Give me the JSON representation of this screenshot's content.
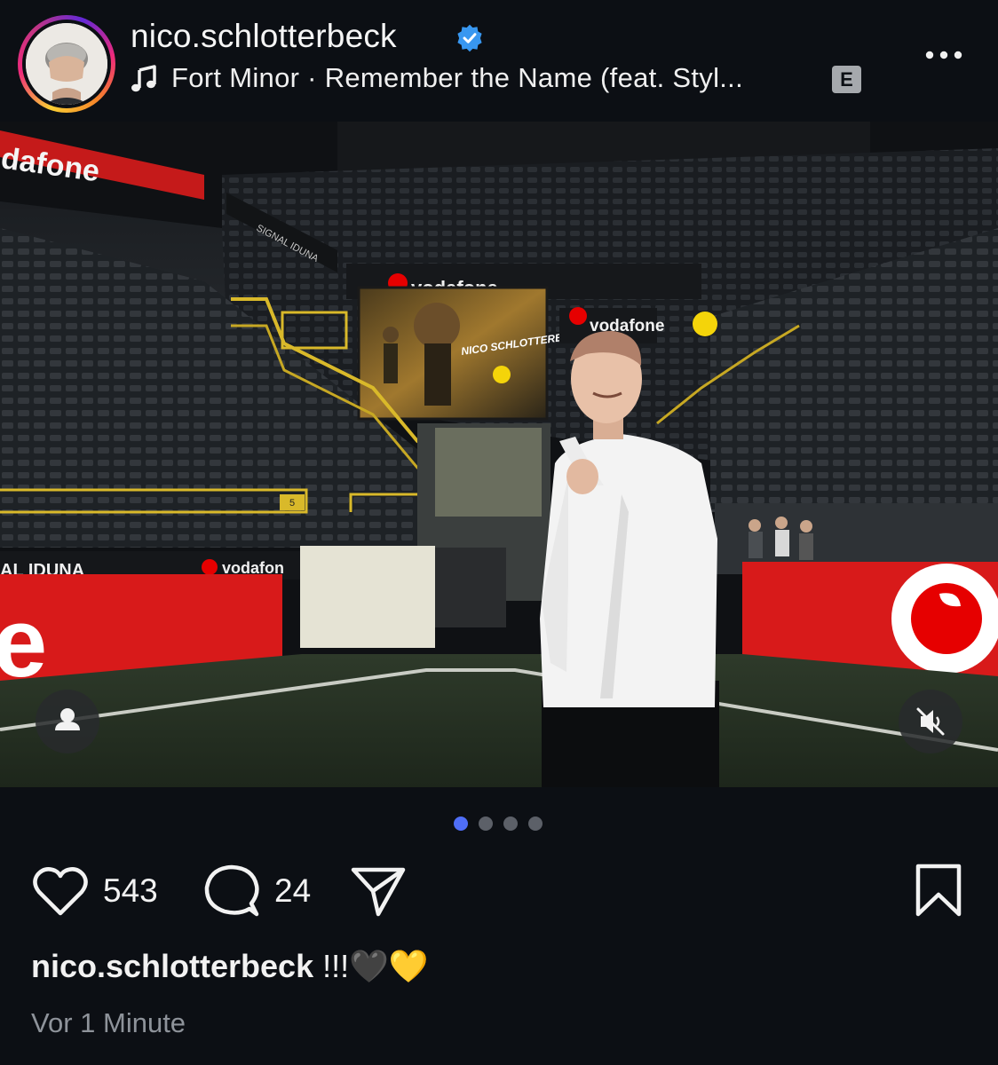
{
  "header": {
    "username": "nico.schlotterbeck",
    "verified": true,
    "song": "Fort Minor · Remember the Name (feat. Styl...",
    "explicit_label": "E",
    "icons": [
      "avatar",
      "verified-icon",
      "music-note-icon",
      "more-icon"
    ]
  },
  "media": {
    "description_icons": [
      "user-tag-icon",
      "muted-speaker-icon"
    ],
    "scene_text": {
      "banner_top_left": "dafone",
      "screen_brand": "vodafone",
      "right_stand_brand": "vodafone",
      "led_board_left_text": "AL IDUNA",
      "led_board_mid_text": "vodafon",
      "led_board_left_big": "e",
      "stand_text": "SIGNAL IDUNA",
      "screen_text": "NICO SCHLOTTERBECK",
      "seat_block_number": "5"
    }
  },
  "carousel": {
    "total": 4,
    "active_index": 0,
    "active_color": "#4f6ef7",
    "inactive_color": "#5c6068"
  },
  "actions": {
    "likes": "543",
    "comments": "24",
    "icons": [
      "heart-icon",
      "comment-icon",
      "share-icon",
      "bookmark-icon"
    ]
  },
  "caption": {
    "username": "nico.schlotterbeck",
    "text": " !!!🖤💛"
  },
  "timestamp": "Vor 1 Minute",
  "colors": {
    "background": "#0c0f14",
    "text": "#f2f2f2",
    "muted_text": "#8e939a",
    "verified": "#3897f0",
    "vodafone_red": "#e60000"
  }
}
